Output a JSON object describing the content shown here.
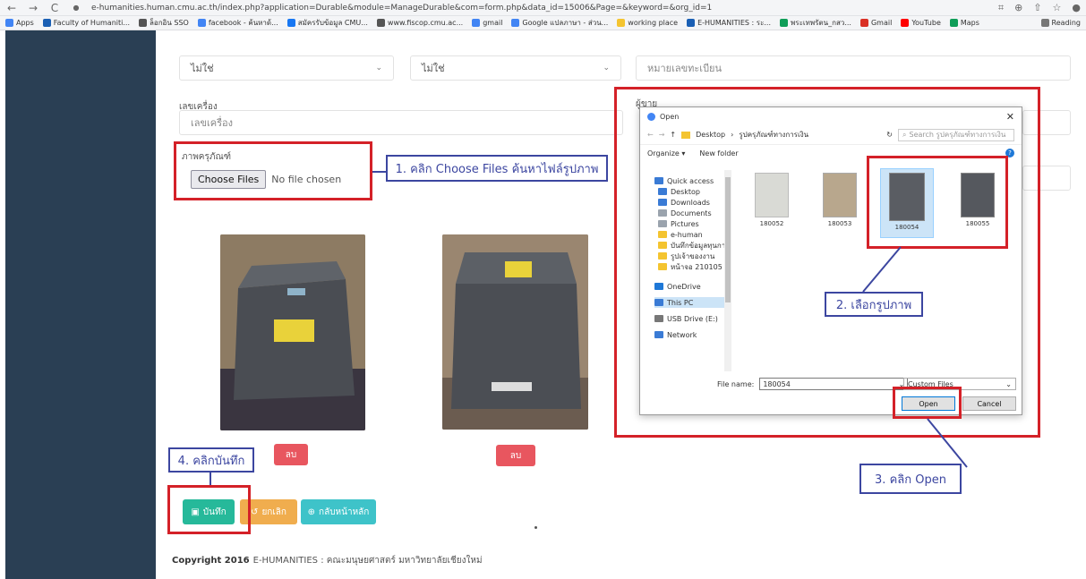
{
  "browser": {
    "url": "e-humanities.human.cmu.ac.th/index.php?application=Durable&module=ManageDurable&com=form.php&data_id=15006&Page=&keyword=&org_id=1",
    "bookmarks": [
      {
        "label": "Apps",
        "color": "#4285f4"
      },
      {
        "label": "Faculty of Humaniti...",
        "color": "#1a5fb4"
      },
      {
        "label": "ล็อกอิน SSO",
        "color": "#555555"
      },
      {
        "label": "facebook - ค้นหาด้...",
        "color": "#4285f4"
      },
      {
        "label": "สมัครรับข้อมูล CMU...",
        "color": "#1877f2"
      },
      {
        "label": "www.fiscop.cmu.ac...",
        "color": "#555555"
      },
      {
        "label": "gmail",
        "color": "#4285f4"
      },
      {
        "label": "Google แปลภาษา - ส่วน...",
        "color": "#4285f4"
      },
      {
        "label": "working place",
        "color": "#f4c430"
      },
      {
        "label": "E-HUMANITIES : ระ...",
        "color": "#1a5fb4"
      },
      {
        "label": "พระเทพรัตน_กสว...",
        "color": "#0f9d58"
      },
      {
        "label": "Gmail",
        "color": "#d93025"
      },
      {
        "label": "YouTube",
        "color": "#ff0000"
      },
      {
        "label": "Maps",
        "color": "#0f9d58"
      }
    ],
    "reading_list": "Reading"
  },
  "form": {
    "select1_value": "ไม่ใช่",
    "select2_value": "ไม่ใช่",
    "registration_placeholder": "หมายเลขทะเบียน",
    "machine_label": "เลขเครื่อง",
    "machine_placeholder": "เลขเครื่อง",
    "photo_label": "ภาพครุภัณฑ์",
    "choose_files": "Choose Files",
    "no_file": "No file chosen",
    "seller_label": "ผู้ขาย",
    "delete_label": "ลบ",
    "save_label": "บันทึก",
    "cancel_label": "ยกเลิก",
    "back_label": "กลับหน้าหลัก"
  },
  "dialog": {
    "title": "Open",
    "path_desktop": "Desktop",
    "path_folder": "รูปครุภัณฑ์ทางการเงิน",
    "search_placeholder": "Search รูปครุภัณฑ์ทางการเงิน",
    "organize": "Organize ▾",
    "new_folder": "New folder",
    "tree": [
      {
        "label": "Quick access",
        "color": "#3a7bd5"
      },
      {
        "label": "Desktop",
        "color": "#3a7bd5"
      },
      {
        "label": "Downloads",
        "color": "#3a7bd5"
      },
      {
        "label": "Documents",
        "color": "#9aa3ad"
      },
      {
        "label": "Pictures",
        "color": "#9aa3ad"
      },
      {
        "label": "e-human",
        "color": "#f4c430"
      },
      {
        "label": "บันทึกข้อมูลทุนการ",
        "color": "#f4c430"
      },
      {
        "label": "รูปเจ้าของงาน",
        "color": "#f4c430"
      },
      {
        "label": "หน้าจอ 210105",
        "color": "#f4c430"
      },
      {
        "label": "OneDrive",
        "color": "#1e78d7"
      },
      {
        "label": "This PC",
        "color": "#3a7bd5"
      },
      {
        "label": "USB Drive (E:)",
        "color": "#777777"
      },
      {
        "label": "Network",
        "color": "#3a7bd5"
      }
    ],
    "files": [
      "180052",
      "180053",
      "180054",
      "180055"
    ],
    "filename_label": "File name:",
    "filename_value": "180054",
    "filetype": "Custom Files",
    "open_label": "Open",
    "cancel_label": "Cancel"
  },
  "annotations": {
    "step1": "1. คลิก Choose Files ค้นหาไฟล์รูปภาพ",
    "step2": "2. เลือกรูปภาพ",
    "step3": "3. คลิก Open",
    "step4": "4. คลิกบันทึก"
  },
  "footer": {
    "copyright": "Copyright 2016",
    "org": "E-HUMANITIES : คณะมนุษยศาสตร์ มหาวิทยาลัยเชียงใหม่"
  },
  "colors": {
    "sidebar": "#2a3f54",
    "save": "#26b99a",
    "cancel": "#f0ad4e",
    "back": "#3ec3c9",
    "delete": "#e8565f",
    "annotation_red": "#d42128",
    "annotation_blue": "#3c46a0"
  }
}
